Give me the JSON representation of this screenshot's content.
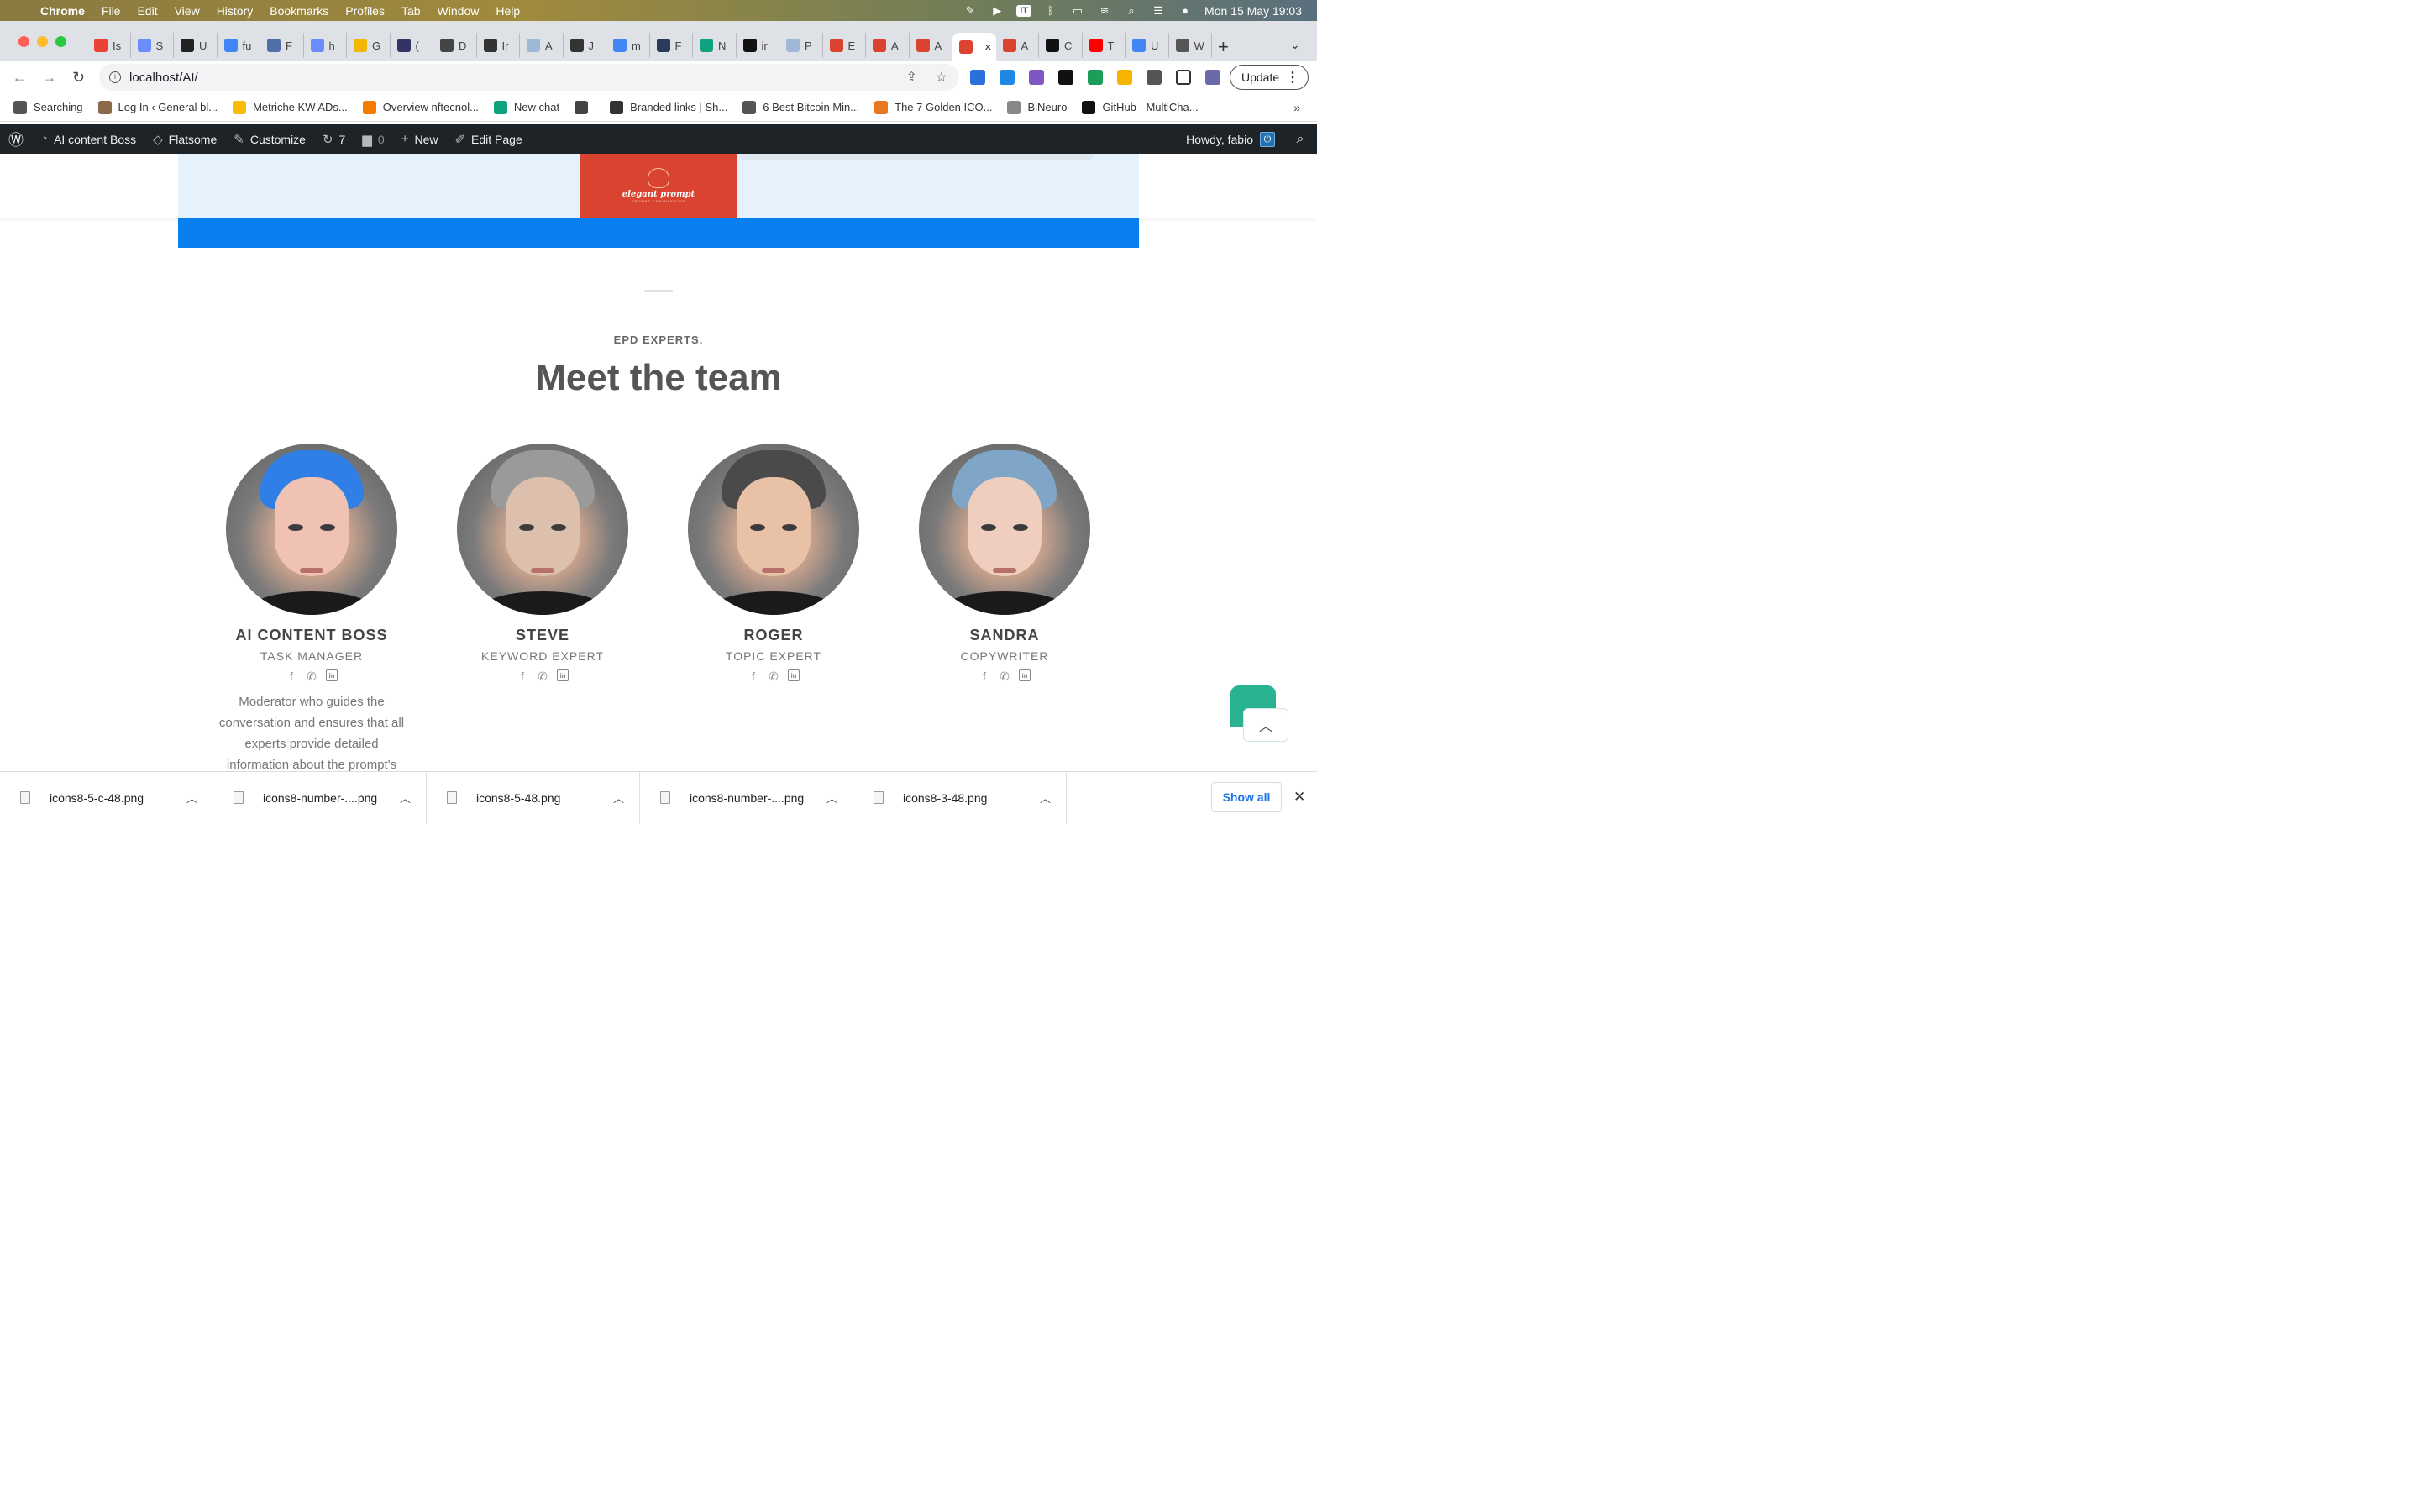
{
  "mac_menubar": {
    "app": "Chrome",
    "menus": [
      "File",
      "Edit",
      "View",
      "History",
      "Bookmarks",
      "Profiles",
      "Tab",
      "Window",
      "Help"
    ],
    "input_badge": "IT",
    "clock": "Mon 15 May  19:03"
  },
  "tabs": [
    {
      "label": "Is",
      "color": "#ea4335"
    },
    {
      "label": "S",
      "color": "#6b8cff"
    },
    {
      "label": "U",
      "color": "#222222"
    },
    {
      "label": "fu",
      "color": "#4285f4"
    },
    {
      "label": "F",
      "color": "#4f6fa8"
    },
    {
      "label": "h",
      "color": "#6b8cff"
    },
    {
      "label": "G",
      "color": "#f2b705"
    },
    {
      "label": "(",
      "color": "#333366"
    },
    {
      "label": "D",
      "color": "#444444"
    },
    {
      "label": "Ir",
      "color": "#333333"
    },
    {
      "label": "A",
      "color": "#9fb8d8"
    },
    {
      "label": "J",
      "color": "#333333"
    },
    {
      "label": "m",
      "color": "#4285f4"
    },
    {
      "label": "F",
      "color": "#2a3b5a"
    },
    {
      "label": "N",
      "color": "#10a37f"
    },
    {
      "label": "ir",
      "color": "#111111"
    },
    {
      "label": "P",
      "color": "#9fb8d8"
    },
    {
      "label": "E",
      "color": "#d9432f"
    },
    {
      "label": "A",
      "color": "#d9432f"
    },
    {
      "label": "A",
      "color": "#d9432f"
    },
    {
      "label": "",
      "color": "#d9432f",
      "active": true
    },
    {
      "label": "A",
      "color": "#d9432f"
    },
    {
      "label": "C",
      "color": "#111111"
    },
    {
      "label": "T",
      "color": "#ff0000"
    },
    {
      "label": "U",
      "color": "#4285f4"
    },
    {
      "label": "W",
      "color": "#555555"
    }
  ],
  "toolbar": {
    "url": "localhost/AI/",
    "update_label": "Update"
  },
  "bookmarks": [
    {
      "label": "Searching",
      "color": "#555555"
    },
    {
      "label": "Log In ‹ General bl...",
      "color": "#8a6a4a"
    },
    {
      "label": "Metriche KW ADs...",
      "color": "#fbbc04"
    },
    {
      "label": "Overview nftecnol...",
      "color": "#f57c00"
    },
    {
      "label": "New chat",
      "color": "#10a37f"
    },
    {
      "label": "",
      "color": "#444444"
    },
    {
      "label": "Branded links | Sh...",
      "color": "#333333"
    },
    {
      "label": "6 Best Bitcoin Min...",
      "color": "#555555"
    },
    {
      "label": "The 7 Golden ICO...",
      "color": "#e87722"
    },
    {
      "label": "BiNeuro",
      "color": "#888888"
    },
    {
      "label": "GitHub - MultiCha...",
      "color": "#111111"
    }
  ],
  "wp_admin_bar": {
    "site_name": "AI content Boss",
    "theme": "Flatsome",
    "customize": "Customize",
    "updates_count": "7",
    "comments_count": "0",
    "new_label": "New",
    "edit_label": "Edit Page",
    "howdy": "Howdy, fabio"
  },
  "page": {
    "logo_text": "elegant prompt",
    "logo_sub": "PROMPT ENGINEERING",
    "eyebrow": "EPD EXPERTS.",
    "title": "Meet the team",
    "team": [
      {
        "name": "AI CONTENT BOSS",
        "role": "TASK MANAGER",
        "bio": "Moderator who guides the conversation and ensures that all experts provide detailed information about the prompt's",
        "hair": "#2f7fe6",
        "skin": "#efc2b4"
      },
      {
        "name": "STEVE",
        "role": "KEYWORD EXPERT",
        "bio": "",
        "hair": "#9a9a9a",
        "skin": "#dcc0ad"
      },
      {
        "name": "ROGER",
        "role": "TOPIC EXPERT",
        "bio": "",
        "hair": "#4a4a4a",
        "skin": "#e9c1a6"
      },
      {
        "name": "SANDRA",
        "role": "COPYWRITER",
        "bio": "",
        "hair": "#7fa6c6",
        "skin": "#efcdbf"
      }
    ]
  },
  "downloads": {
    "items": [
      "icons8-5-c-48.png",
      "icons8-number-....png",
      "icons8-5-48.png",
      "icons8-number-....png",
      "icons8-3-48.png"
    ],
    "show_all": "Show all"
  },
  "colors": {
    "wp_bar": "#1d2327",
    "blue_strip": "#0a7ff0",
    "logo_card": "#d9432f",
    "chat_widget": "#2ab393"
  }
}
